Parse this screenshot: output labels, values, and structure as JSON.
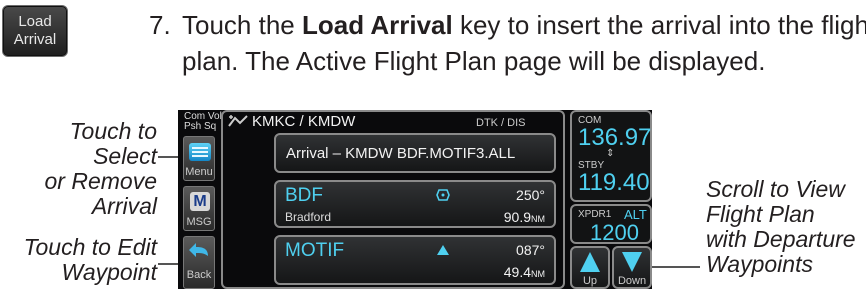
{
  "step": {
    "key_label_line1": "Load",
    "key_label_line2": "Arrival",
    "number": "7.",
    "line1_pre": "Touch the ",
    "line1_bold": "Load Arrival",
    "line1_post": " key to insert the arrival into the flight",
    "line2": "plan. The Active Flight Plan page will be displayed."
  },
  "callouts": {
    "select_remove": [
      "Touch to Select",
      "or Remove",
      "Arrival"
    ],
    "edit_waypoint": [
      "Touch to Edit",
      "Waypoint"
    ],
    "scroll": [
      "Scroll to View",
      "Flight Plan",
      "with Departure",
      "Waypoints"
    ]
  },
  "screen": {
    "left_bar": {
      "com_vol": "Com Vol",
      "psh_sq": "Psh Sq",
      "menu": "Menu",
      "msg": "MSG",
      "back": "Back"
    },
    "header": {
      "route": "KMKC / KMDW",
      "cols": "DTK / DIS"
    },
    "arrival_row": "Arrival – KMDW BDF.MOTIF3.ALL",
    "waypoints": [
      {
        "id": "BDF",
        "name": "Bradford",
        "dtk": "250°",
        "dis": "90.9",
        "unit": "NM"
      },
      {
        "id": "MOTIF",
        "name": "",
        "dtk": "087°",
        "dis": "49.4",
        "unit": "NM"
      }
    ],
    "right_bar": {
      "com_label": "COM",
      "com_freq": "136.97",
      "stby_label": "STBY",
      "stby_freq": "119.40",
      "xpdr_label": "XPDR1",
      "xpdr_mode": "ALT",
      "xpdr_code": "1200",
      "up": "Up",
      "down": "Down"
    }
  },
  "colors": {
    "cyan": "#4fd0f0",
    "bg_screen": "#0a0a0c",
    "text": "#231f20"
  }
}
